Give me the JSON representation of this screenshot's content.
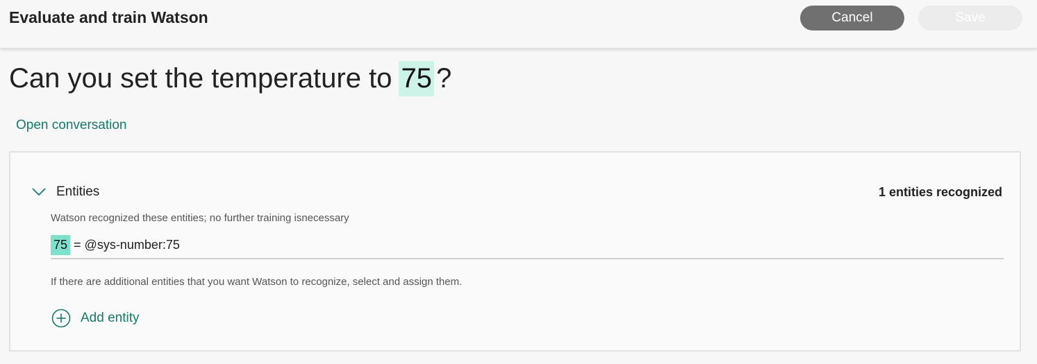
{
  "header": {
    "title": "Evaluate and train Watson",
    "cancel_label": "Cancel",
    "save_label": "Save"
  },
  "utterance": {
    "before": "Can you set the temperature to",
    "highlight": "75",
    "after": "?"
  },
  "open_conversation_label": "Open conversation",
  "entities_section": {
    "label": "Entities",
    "count_text": "1 entities recognized",
    "recognized_note": "Watson recognized these entities; no further training isnecessary",
    "entity": {
      "value": "75",
      "mapping": "= @sys-number:75"
    },
    "additional_note": "If there are additional entities that you want Watson to recognize, select and assign them.",
    "add_entity_label": "Add entity",
    "icons": {
      "toggle": "chevron-down-icon",
      "add": "plus-circle-icon"
    }
  },
  "colors": {
    "accent": "#147a6a",
    "highlight_light": "#cdf3e9",
    "highlight_strong": "#7fe0cc",
    "cancel_button": "#707070"
  }
}
